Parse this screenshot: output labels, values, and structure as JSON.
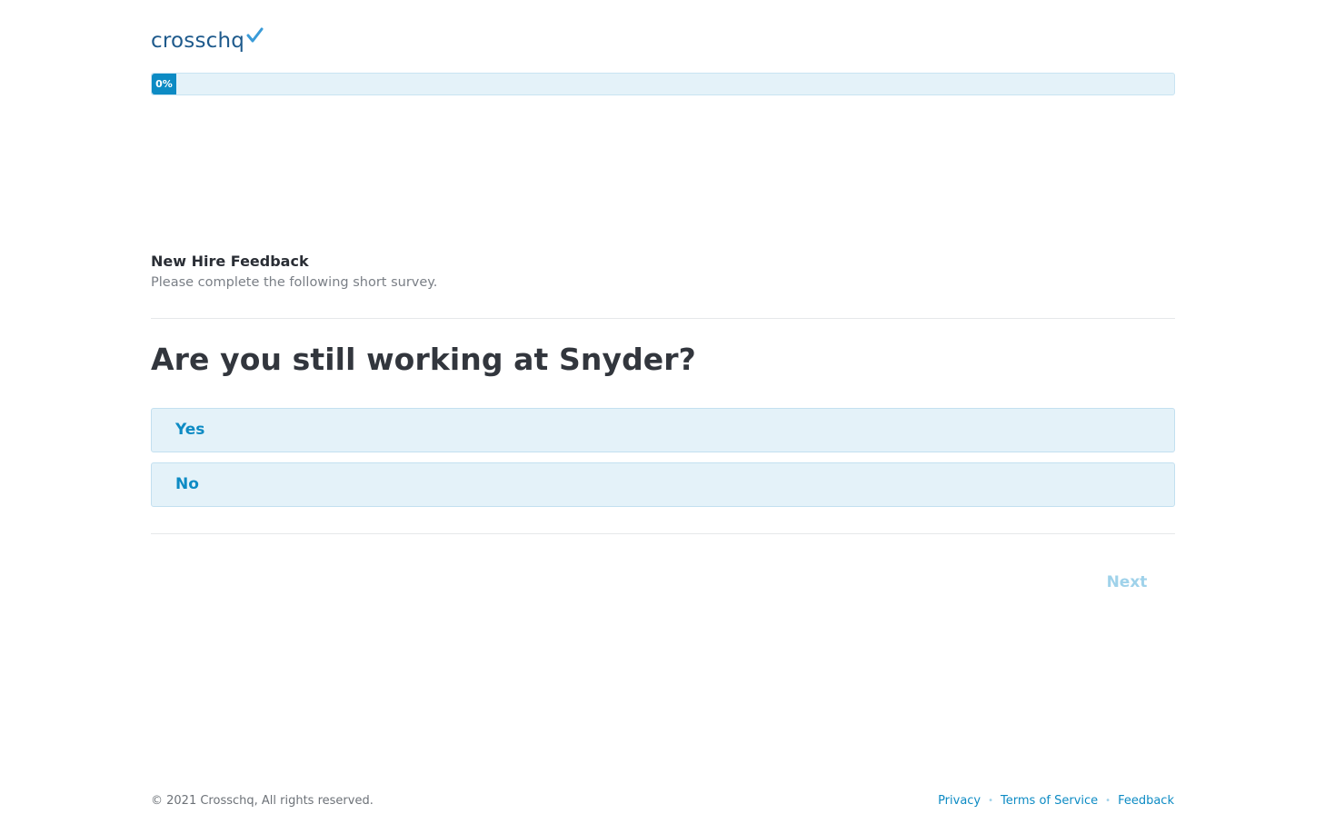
{
  "brand": {
    "logo_text": "crosschq",
    "logo_color": "#1e5a8c",
    "check_color": "#3a9bd8"
  },
  "progress": {
    "label": "0%",
    "value_percent": 0
  },
  "survey": {
    "title": "New Hire Feedback",
    "subtitle": "Please complete the following short survey."
  },
  "question": {
    "text": "Are you still working at Snyder?",
    "options": [
      {
        "label": "Yes"
      },
      {
        "label": "No"
      }
    ]
  },
  "actions": {
    "next_label": "Next"
  },
  "footer": {
    "copyright": "© 2021 Crosschq, All rights reserved.",
    "links": [
      {
        "label": "Privacy"
      },
      {
        "label": "Terms of Service"
      },
      {
        "label": "Feedback"
      }
    ],
    "separator": "•"
  },
  "colors": {
    "accent": "#0d8bc4",
    "option_bg": "#e4f2f9",
    "option_border": "#c3e0f0",
    "disabled_text": "#9fd2ea"
  }
}
